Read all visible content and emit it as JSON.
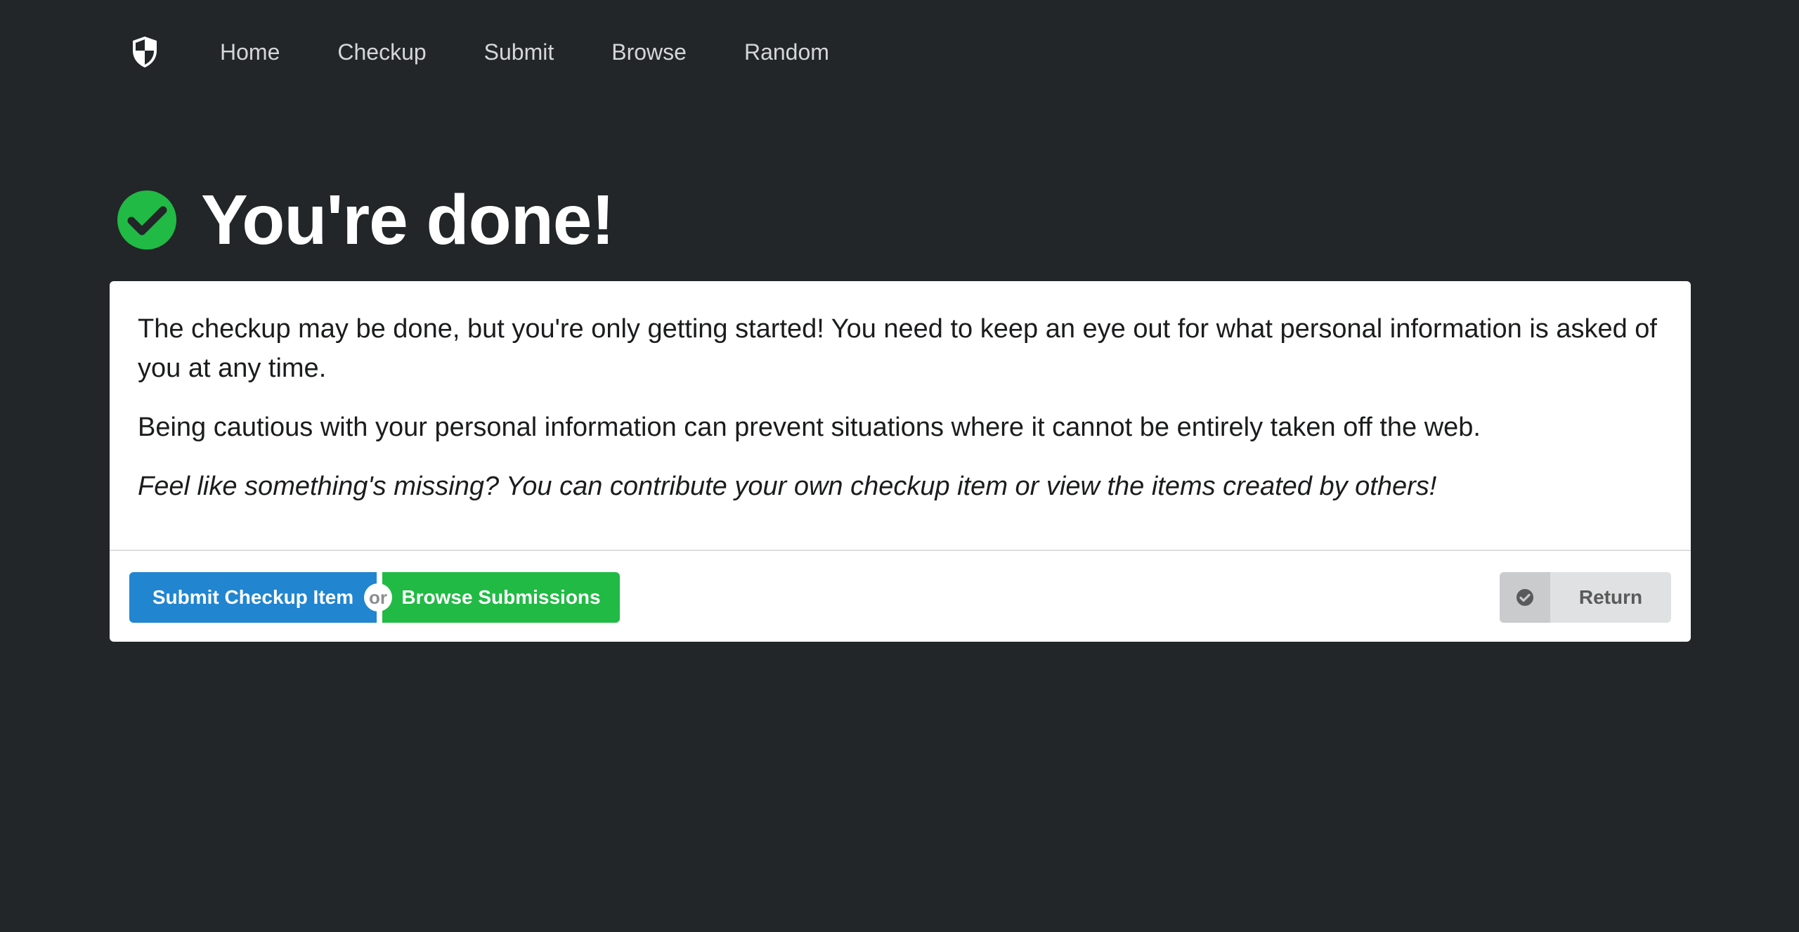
{
  "nav": {
    "logo_icon": "shield-icon",
    "links": [
      "Home",
      "Checkup",
      "Submit",
      "Browse",
      "Random"
    ]
  },
  "header": {
    "icon": "check-circle-icon",
    "title": "You're done!"
  },
  "card": {
    "paragraphs": [
      "The checkup may be done, but you're only getting started! You need to keep an eye out for what personal information is asked of you at any time.",
      "Being cautious with your personal information can prevent situations where it cannot be entirely taken off the web.",
      "Feel like something's missing? You can contribute your own checkup item or view the items created by others!"
    ],
    "actions": {
      "submit_label": "Submit Checkup Item",
      "or_label": "or",
      "browse_label": "Browse Submissions",
      "return_label": "Return",
      "return_icon": "check-circle-icon"
    }
  },
  "colors": {
    "background": "#222628",
    "blue": "#2185d0",
    "green": "#21ba45",
    "grey_button": "#e0e1e2"
  }
}
